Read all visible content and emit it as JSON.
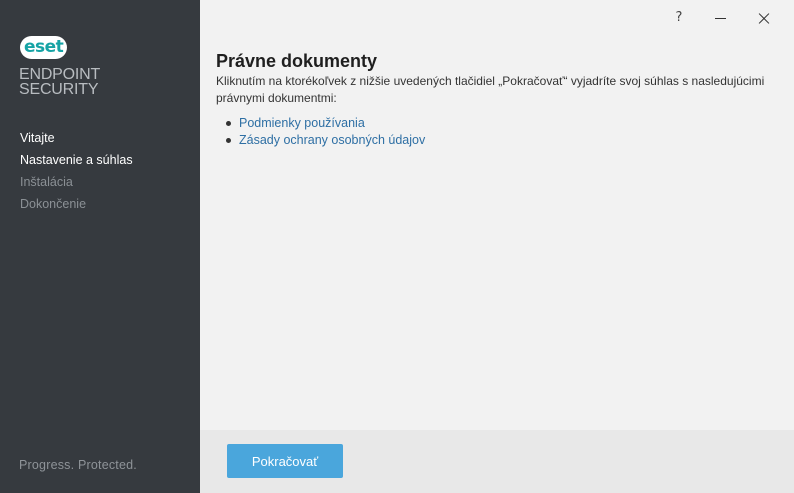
{
  "brand": {
    "logo_text": "eset",
    "product_line1": "ENDPOINT",
    "product_line2": "SECURITY",
    "tagline": "Progress. Protected."
  },
  "nav": {
    "items": [
      {
        "label": "Vitajte",
        "state": "done"
      },
      {
        "label": "Nastavenie a súhlas",
        "state": "current"
      },
      {
        "label": "Inštalácia",
        "state": "pending"
      },
      {
        "label": "Dokončenie",
        "state": "pending"
      }
    ]
  },
  "titlebar": {
    "help": "?"
  },
  "content": {
    "title": "Právne dokumenty",
    "description": "Kliknutím na ktorékoľvek z nižšie uvedených tlačidiel „Pokračovať“ vyjadríte svoj súhlas s nasledujúcimi právnymi dokumentmi:",
    "links": [
      "Podmienky používania",
      "Zásady ochrany osobných údajov"
    ]
  },
  "footer": {
    "continue_label": "Pokračovať"
  },
  "colors": {
    "sidebar_bg": "#363a3f",
    "accent": "#4aa6dc",
    "link": "#2e6fa4",
    "logo": "#16a3a5"
  }
}
